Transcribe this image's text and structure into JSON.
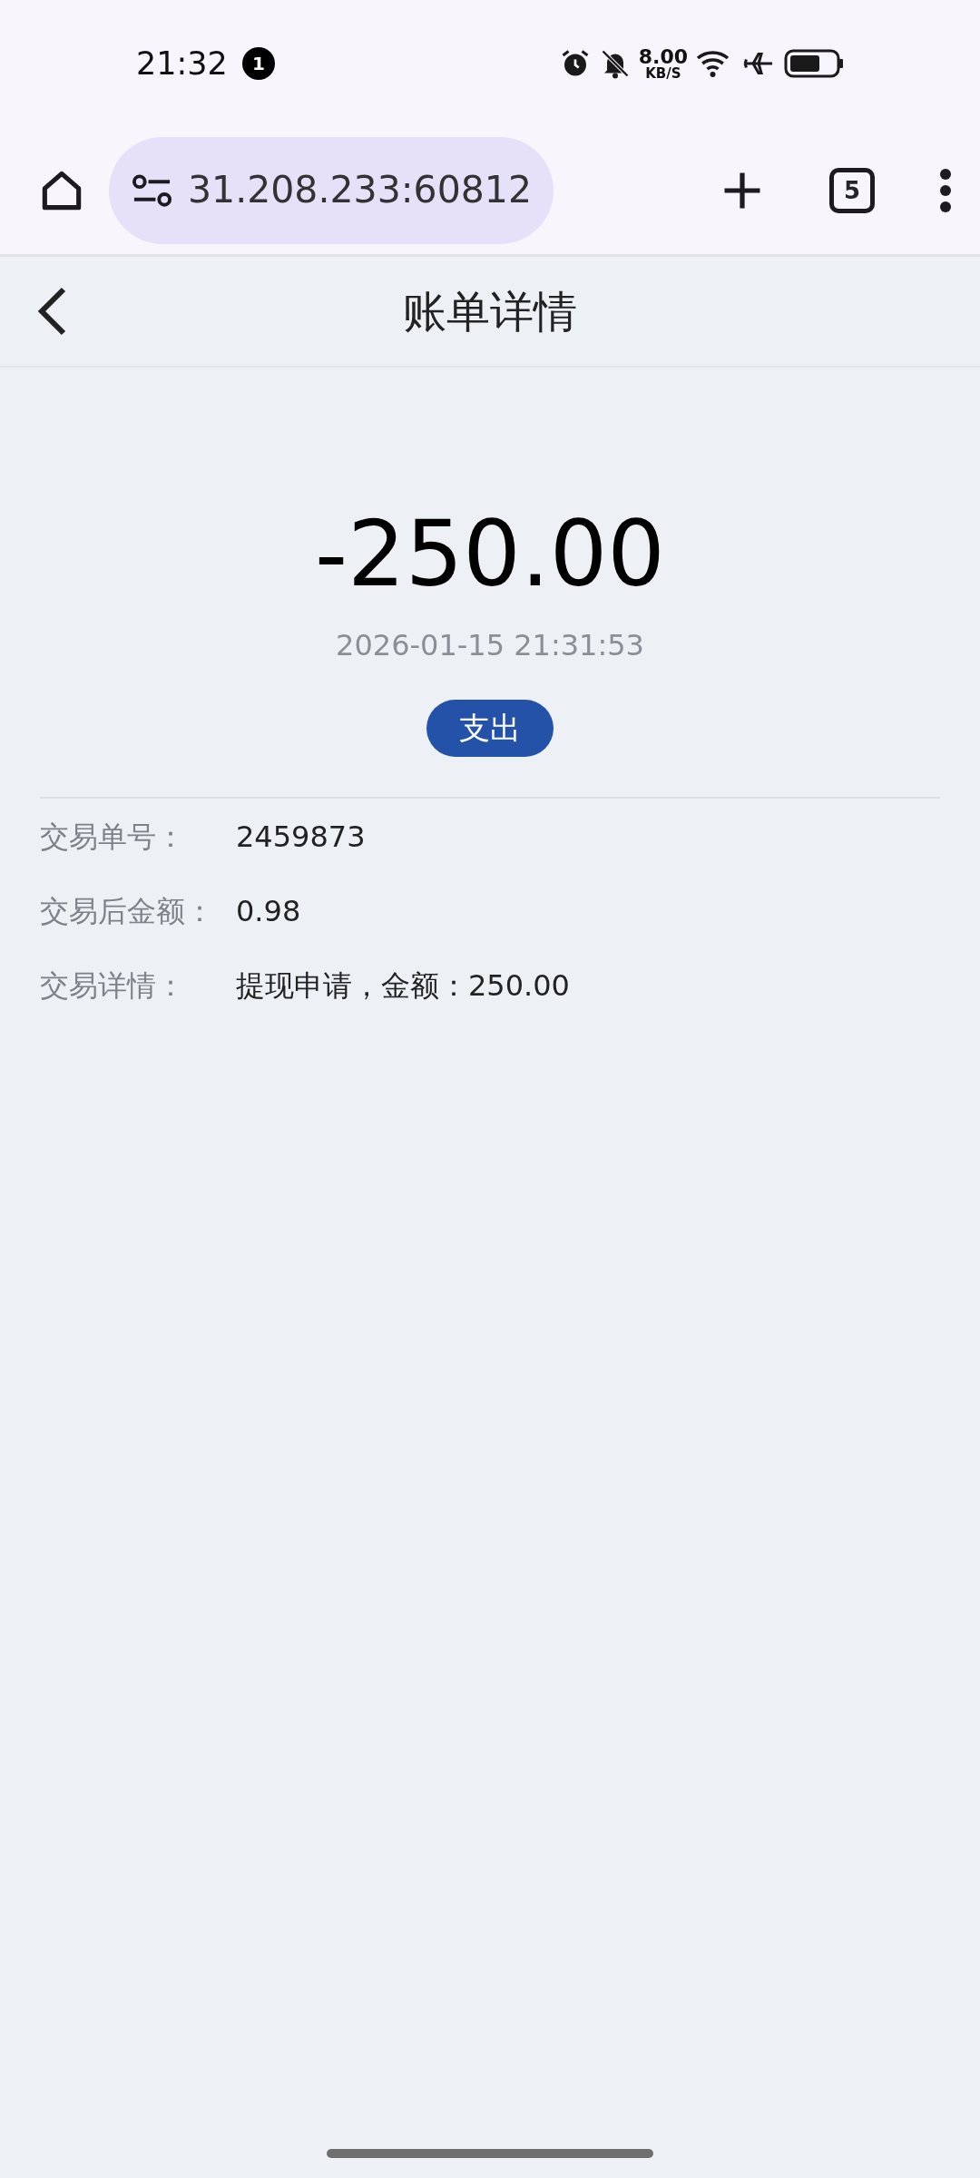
{
  "status_bar": {
    "time": "21:32",
    "notification_count": "1",
    "net_speed": "8.00",
    "net_speed_unit": "KB/S"
  },
  "browser": {
    "url": "31.208.233:60812",
    "tab_count": "5"
  },
  "header": {
    "title": "账单详情"
  },
  "amount": "-250.00",
  "datetime": "2026-01-15 21:31:53",
  "type_tag": {
    "label": "支出",
    "kind": "expense"
  },
  "details": [
    {
      "label": "交易单号：",
      "value": "2459873"
    },
    {
      "label": "交易后金额：",
      "value": "0.98"
    },
    {
      "label": "交易详情：",
      "value": "提现申请，金额：250.00"
    }
  ]
}
